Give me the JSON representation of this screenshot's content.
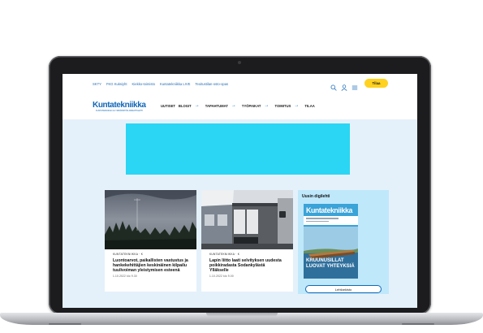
{
  "site": {
    "top_links": [
      "SKTY",
      "FKG Kuksiyht",
      "Kiekko-toimisto",
      "Kuntatekniikka LIVE",
      "Teoitustilan-osto-opas"
    ],
    "subscribe_label": "Tilaa",
    "logo_text": "Kuntatekniikka",
    "logo_tagline": "KUNTATEKNIIKAN JA YMPÄRISTÖN AMMATTILEHTI",
    "nav": [
      {
        "label": "UUTISET",
        "arrow": false
      },
      {
        "label": "BLOGIT",
        "arrow": true
      },
      {
        "label": "TAPAHTUMAT",
        "arrow": true
      },
      {
        "label": "TYÖPAIKAT",
        "arrow": true
      },
      {
        "label": "TOIMITUS",
        "arrow": true
      },
      {
        "label": "TILAA",
        "arrow": false
      }
    ]
  },
  "cards": [
    {
      "category": "KUNTATEKNIIKKA · K",
      "title": "Luontoarvot, paikallisten vastustus ja hankekehittäjien keskinäinen kilpailu tuulivoiman yleistymisen esteenä",
      "date": "1.10.2022 klo 9.30"
    },
    {
      "category": "KUNTATEKNIIKKA · K",
      "title": "Lapin liitto laati selvityksen uudesta poikkiradasta Sodankylästä Ylläkselle",
      "date": "1.10.2022 klo 9.00"
    }
  ],
  "magazine": {
    "heading": "Uusin digilehti",
    "cover_title": "Kuntatekniikka",
    "headline_1": "KRUUNUSILLAT",
    "headline_2": "LUOVAT YHTEYKSIÄ",
    "archive_label": "Lehtiarkisto"
  },
  "colors": {
    "brand_blue": "#1167b8",
    "page_bg": "#e4f1fb",
    "ad_cyan": "#2ad6f3",
    "subscribe_yellow": "#ffd21f",
    "sidebar_bg": "#bfe8fb"
  },
  "icons": {
    "search": "search-icon",
    "user": "user-icon",
    "menu": "menu-icon",
    "arrow": "arrow-right-icon"
  }
}
